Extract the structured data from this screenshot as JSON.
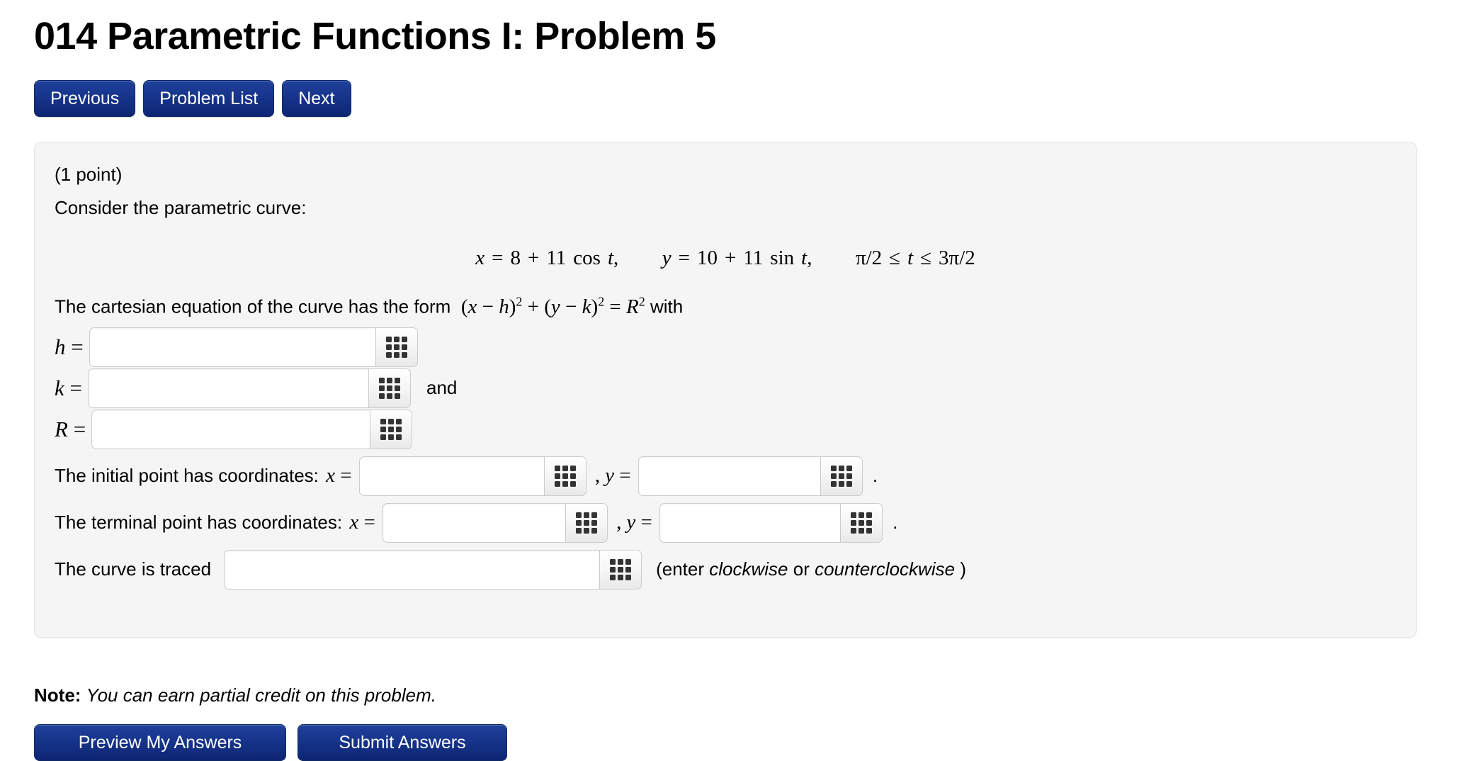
{
  "page": {
    "title": "014 Parametric Functions I: Problem 5"
  },
  "nav": {
    "buttons": [
      {
        "label": "Previous",
        "name": "previous-button"
      },
      {
        "label": "Problem List",
        "name": "problem-list-button"
      },
      {
        "label": "Next",
        "name": "next-button"
      }
    ]
  },
  "problem": {
    "points": "(1 point)",
    "intro": "Consider the parametric curve:",
    "equation": {
      "x_var": "x",
      "x_eq": "=",
      "x_rhs_num1": "8",
      "x_plus": "+",
      "x_coef": "11",
      "x_fn": "cos",
      "x_param": "t",
      "x_comma": ",",
      "y_var": "y",
      "y_eq": "=",
      "y_rhs_num1": "10",
      "y_plus": "+",
      "y_coef": "11",
      "y_fn": "sin",
      "y_param": "t",
      "y_comma": ",",
      "domain_lower": "π/2",
      "domain_rel1": "≤",
      "domain_var": "t",
      "domain_rel2": "≤",
      "domain_upper": "3π/2",
      "plain": "x = 8 + 11 cos t,    y = 10 + 11 sin t,    π/2 ≤ t ≤ 3π/2"
    },
    "cartesian": {
      "prefix": "The cartesian equation of the curve has the form",
      "open_paren": "(",
      "x": "x",
      "minus": "−",
      "h": "h",
      "close_paren": ")",
      "exp2_a": "2",
      "plus": "+",
      "open_paren2": "(",
      "y": "y",
      "minus2": "−",
      "k": "k",
      "close_paren2": ")",
      "exp2_b": "2",
      "equals": "=",
      "R": "R",
      "exp2_c": "2",
      "suffix": "with",
      "plain": "The cartesian equation of the curve has the form (x − h)² + (y − k)² = R² with"
    },
    "answers": {
      "h_label": "h",
      "h_eq": "=",
      "h_value": "",
      "k_label": "k",
      "k_eq": "=",
      "k_value": "",
      "and_word": "and",
      "R_label": "R",
      "R_eq": "=",
      "R_value": "",
      "initial_prefix": "The initial point has coordinates:",
      "initial_x_var": "x",
      "initial_x_eq": "=",
      "initial_x_value": "",
      "initial_comma": ",",
      "initial_y_var": "y",
      "initial_y_eq": "=",
      "initial_y_value": "",
      "initial_period": ".",
      "terminal_prefix": "The terminal point has coordinates:",
      "terminal_x_var": "x",
      "terminal_x_eq": "=",
      "terminal_x_value": "",
      "terminal_comma": ",",
      "terminal_y_var": "y",
      "terminal_y_eq": "=",
      "terminal_y_value": "",
      "terminal_period": ".",
      "traced_prefix": "The curve is traced",
      "traced_value": "",
      "traced_hint_open": "(enter",
      "traced_hint_option1": "clockwise",
      "traced_hint_or": "or",
      "traced_hint_option2": "counterclockwise",
      "traced_hint_close": ")"
    },
    "keyboard_icon_name": "keyboard-grid-icon"
  },
  "note": {
    "label": "Note:",
    "text": "You can earn partial credit on this problem."
  },
  "bottom_actions": {
    "buttons": [
      {
        "label": "Preview My Answers",
        "name": "preview-my-answers-button"
      },
      {
        "label": "Submit Answers",
        "name": "submit-answers-button"
      }
    ]
  },
  "colors": {
    "button_blue": "#17358c",
    "button_blue_dark": "#0e2573",
    "panel_bg": "#f5f5f5",
    "panel_border": "#e3e3e3",
    "input_border": "#cccccc",
    "grid_dot": "#333333",
    "page_bg": "#ffffff"
  }
}
